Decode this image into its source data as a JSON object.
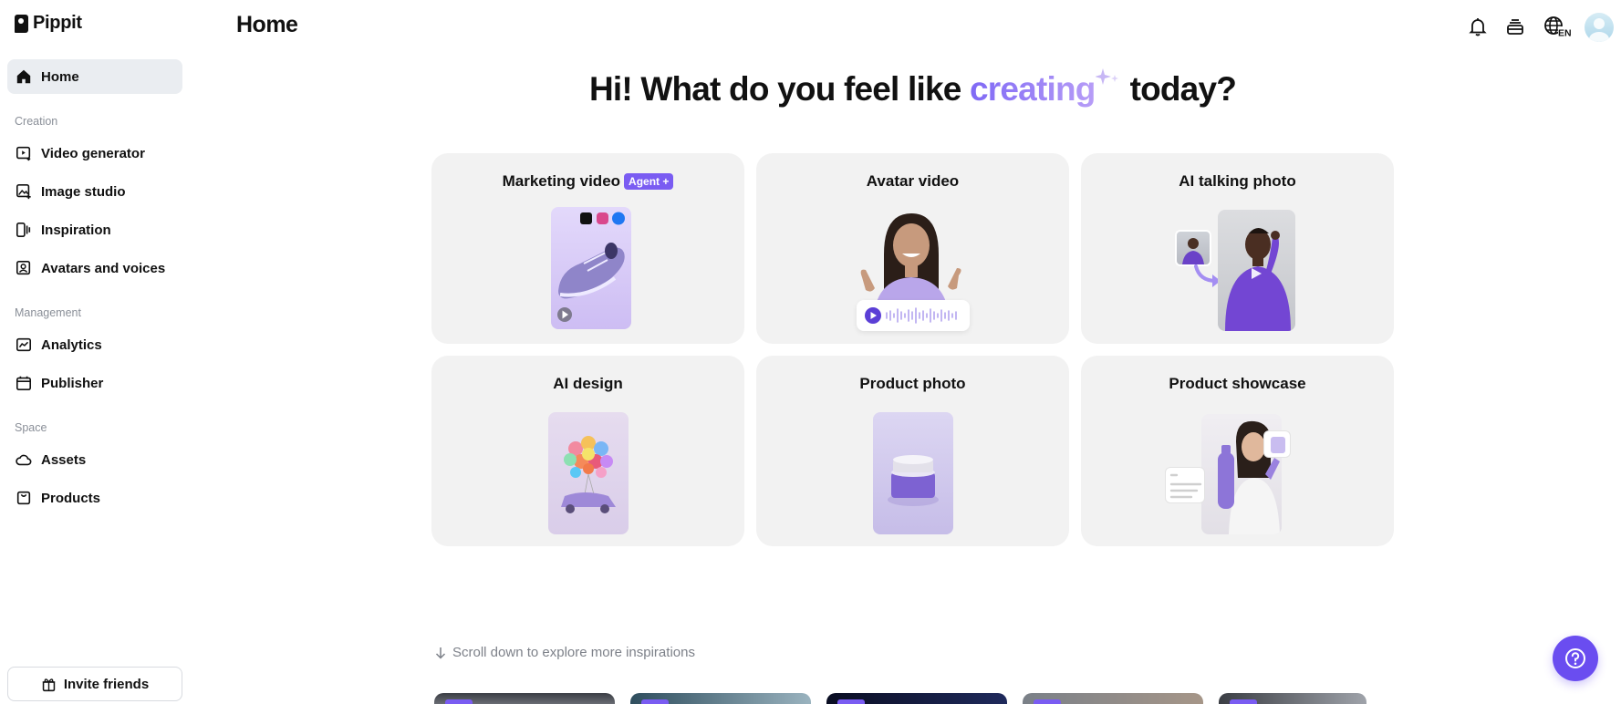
{
  "app": {
    "name": "Pippit"
  },
  "header": {
    "title": "Home",
    "language": "EN"
  },
  "sidebar": {
    "home": "Home",
    "sections": {
      "creation": "Creation",
      "management": "Management",
      "space": "Space"
    },
    "creation_items": [
      "Video generator",
      "Image studio",
      "Inspiration",
      "Avatars and voices"
    ],
    "management_items": [
      "Analytics",
      "Publisher"
    ],
    "space_items": [
      "Assets",
      "Products"
    ],
    "invite": "Invite friends"
  },
  "hero": {
    "before": "Hi! What do you feel like ",
    "accent": "creating",
    "after": "today?"
  },
  "cards": [
    {
      "title": "Marketing video",
      "badge": "Agent +"
    },
    {
      "title": "Avatar video"
    },
    {
      "title": "AI talking photo"
    },
    {
      "title": "AI design"
    },
    {
      "title": "Product photo"
    },
    {
      "title": "Product showcase"
    }
  ],
  "scroll_hint": "Scroll down to explore more inspirations",
  "colors": {
    "accent": "#7a5cf2",
    "active_bg": "#eaedf1",
    "card_bg": "#f2f2f2",
    "help": "#6a4df0"
  }
}
